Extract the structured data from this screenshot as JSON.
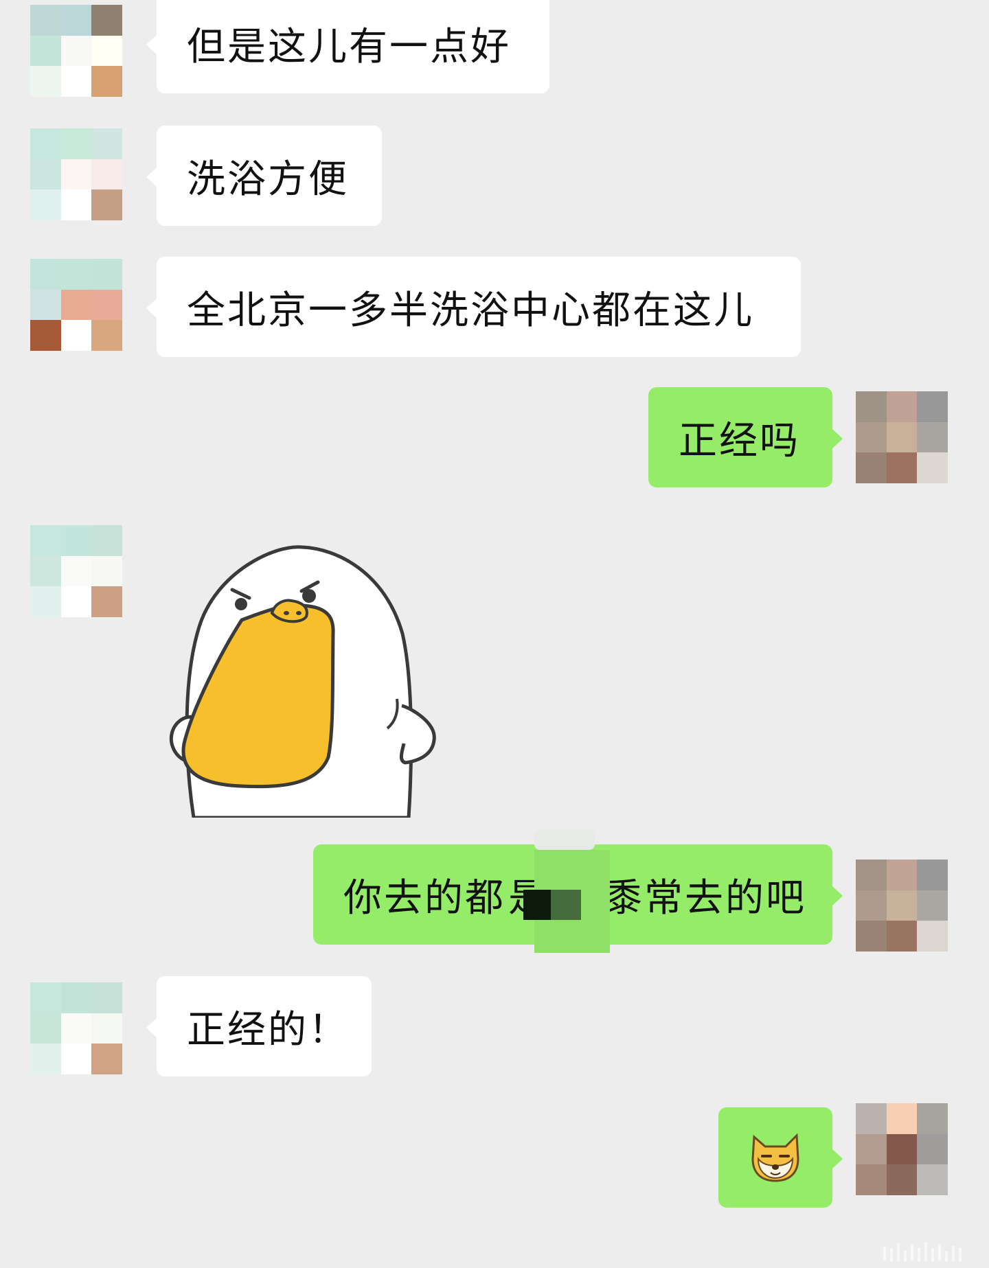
{
  "messages": [
    {
      "from": "other",
      "type": "text",
      "text": "但是这儿有一点好"
    },
    {
      "from": "other",
      "type": "text",
      "text": "洗浴方便"
    },
    {
      "from": "other",
      "type": "text",
      "text": "全北京一多半洗浴中心都在这儿"
    },
    {
      "from": "me",
      "type": "text",
      "text": "正经吗"
    },
    {
      "from": "other",
      "type": "sticker",
      "icon": "angry-duck-sticker-icon"
    },
    {
      "from": "me",
      "type": "text",
      "text_before": "你去的都",
      "text_redacted": "是",
      "text_after": "黍常去的吧"
    },
    {
      "from": "other",
      "type": "text",
      "text": "正经的！"
    },
    {
      "from": "me",
      "type": "emoji",
      "icon": "doge-emoji-icon"
    }
  ],
  "colors": {
    "background": "#ededed",
    "bubble_incoming": "#ffffff",
    "bubble_outgoing": "#95ec69"
  },
  "avatars": {
    "other_a": [
      "#bfd8d6",
      "#bcd7da",
      "#908170",
      "#c5e5da",
      "#f8f9f7",
      "#fffff5",
      "#ecf6ef",
      "#ffffff",
      "#d8a270"
    ],
    "other_b": [
      "#c6e6de",
      "#c8ead9",
      "#d1e6e3",
      "#cbe6e0",
      "#fbf6f4",
      "#f9ebea",
      "#dff0ef",
      "#ffffff",
      "#c49f86"
    ],
    "other_c": [
      "#c4e4db",
      "#c3e4d8",
      "#c3e2d8",
      "#cfe3e2",
      "#e8ab91",
      "#e9ab98",
      "#a75a38",
      "#ffffff",
      "#d8a67f"
    ],
    "other_d": [
      "#c7e6dd",
      "#c2e5dc",
      "#c6e2d9",
      "#cde7de",
      "#fafaf9",
      "#f7f8f4",
      "#e2f0ee",
      "#ffffff",
      "#cba085"
    ],
    "other_e": [
      "#c7e7dc",
      "#c2e3d8",
      "#c7e1d9",
      "#c8e5d9",
      "#fafaf8",
      "#f5f8f2",
      "#e3f1ec",
      "#ffffff",
      "#cea386"
    ],
    "me_a": [
      "#9f9387",
      "#bfa195",
      "#989898",
      "#ad9b8c",
      "#c8b09a",
      "#a9a5a1",
      "#998274",
      "#9b715f",
      "#dcd8d1"
    ],
    "me_b": [
      "#a29386",
      "#c0a597",
      "#999999",
      "#ae9b8d",
      "#c7b29c",
      "#aaa6a2",
      "#988375",
      "#9a7462",
      "#dbd7d0"
    ],
    "me_c": [
      "#bcb2ad",
      "#f9cfb3",
      "#a7a49e",
      "#b49d90",
      "#84594b",
      "#a09d9c",
      "#a5897b",
      "#8b6a5d",
      "#bdbbb8"
    ]
  }
}
